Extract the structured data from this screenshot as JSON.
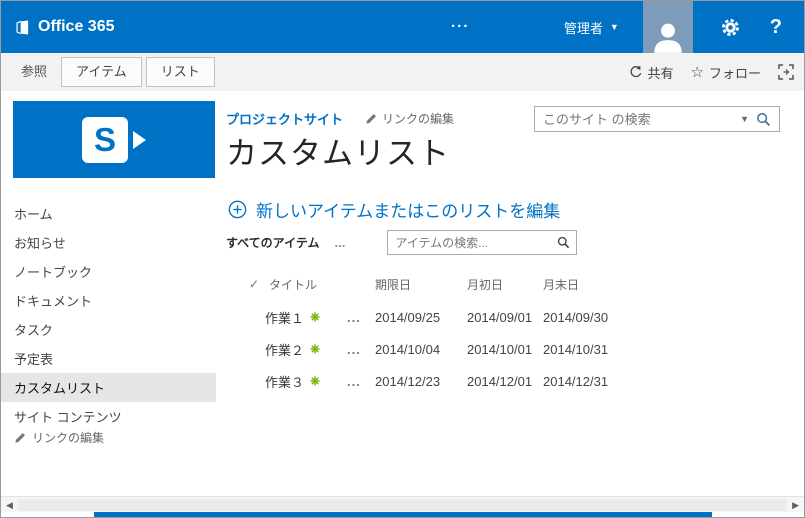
{
  "colors": {
    "suite_blue": "#0072C6",
    "link_blue": "#0072C6",
    "new_badge_green": "#76B900",
    "selected_nav_bg": "#E6E6E6"
  },
  "suite_bar": {
    "brand": "Office 365",
    "more_menu": "...",
    "user_menu": "管理者",
    "help_label": "?"
  },
  "ribbon": {
    "tab_browse": "参照",
    "tab_items": "アイテム",
    "tab_list": "リスト",
    "share_label": "共有",
    "follow_label": "フォロー"
  },
  "sidebar": {
    "items": [
      {
        "label": "ホーム"
      },
      {
        "label": "お知らせ"
      },
      {
        "label": "ノートブック"
      },
      {
        "label": "ドキュメント"
      },
      {
        "label": "タスク"
      },
      {
        "label": "予定表"
      },
      {
        "label": "カスタムリスト"
      },
      {
        "label": "サイト コンテンツ"
      }
    ],
    "selected_index": 6,
    "logo_letter": "S",
    "edit_links_label": "リンクの編集"
  },
  "main": {
    "breadcrumb_site": "プロジェクトサイト",
    "edit_links_label": "リンクの編集",
    "site_search_placeholder": "このサイト の検索",
    "page_title": "カスタムリスト",
    "new_item_label": "新しいアイテムまたはこのリストを編集",
    "view_label": "すべてのアイテム",
    "view_more": "...",
    "item_search_placeholder": "アイテムの検索...",
    "table": {
      "check_header": "✓",
      "headers": [
        "タイトル",
        "期限日",
        "月初日",
        "月末日"
      ],
      "row_menu": "...",
      "rows": [
        {
          "title": "作業１",
          "due_date": "2014/09/25",
          "month_start": "2014/09/01",
          "month_end": "2014/09/30"
        },
        {
          "title": "作業２",
          "due_date": "2014/10/04",
          "month_start": "2014/10/01",
          "month_end": "2014/10/31"
        },
        {
          "title": "作業３",
          "due_date": "2014/12/23",
          "month_start": "2014/12/01",
          "month_end": "2014/12/31"
        }
      ]
    }
  },
  "scrollbar": {
    "left_arrow": "◀",
    "right_arrow": "▶"
  }
}
